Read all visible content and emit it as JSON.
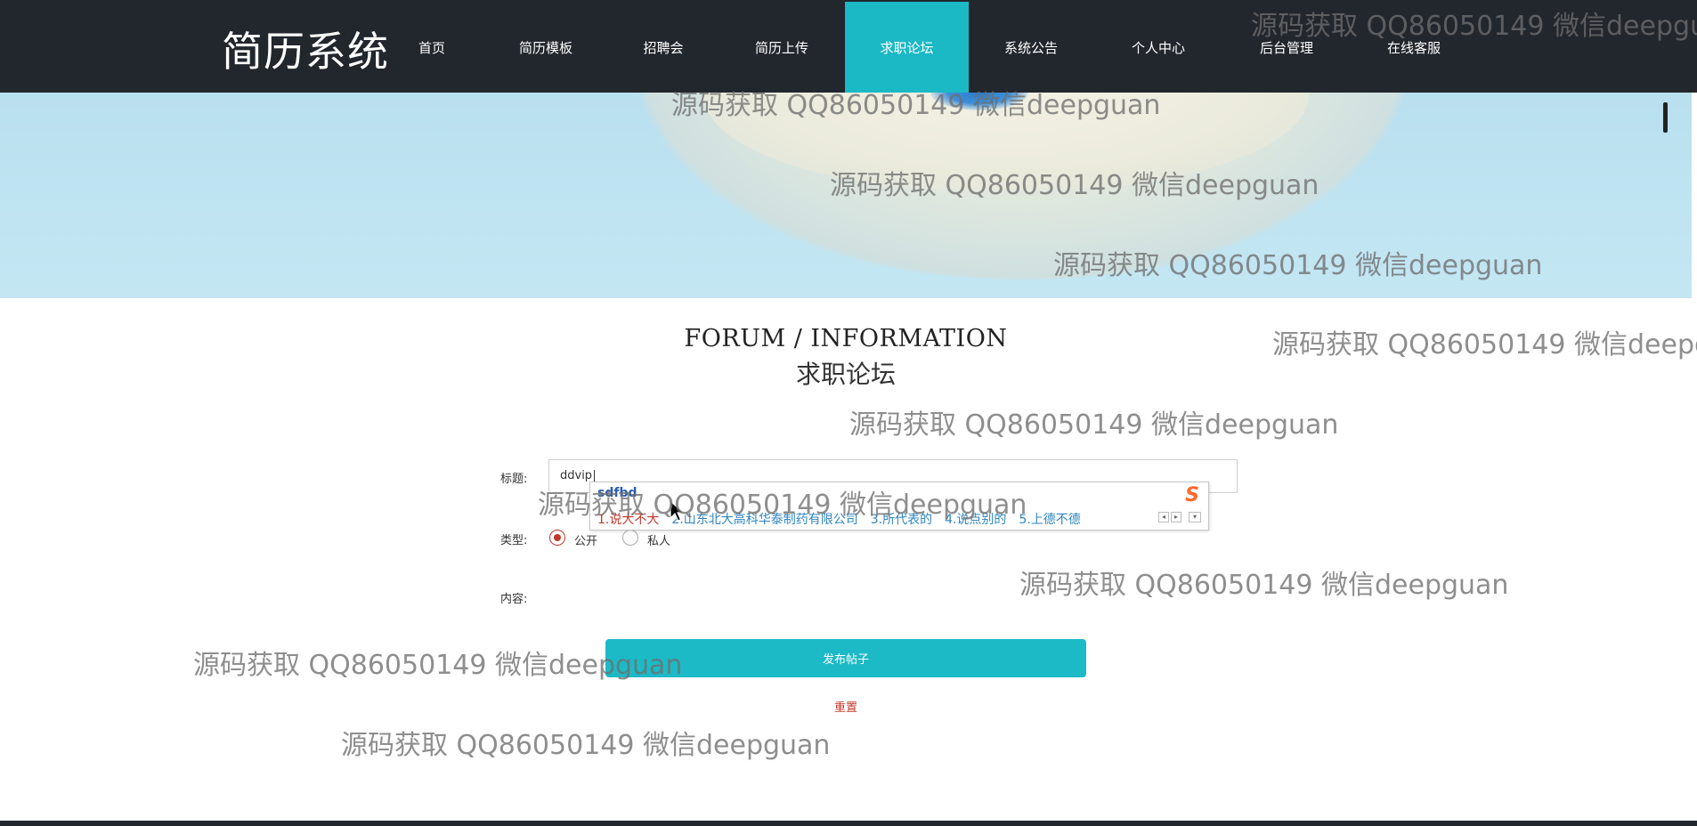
{
  "header": {
    "logo": "简历系统",
    "nav": [
      {
        "label": "首页"
      },
      {
        "label": "简历模板"
      },
      {
        "label": "招聘会"
      },
      {
        "label": "简历上传"
      },
      {
        "label": "求职论坛",
        "active": true
      },
      {
        "label": "系统公告"
      },
      {
        "label": "个人中心"
      },
      {
        "label": "后台管理"
      },
      {
        "label": "在线客服"
      }
    ]
  },
  "section": {
    "title_en": "FORUM / INFORMATION",
    "title_cn": "求职论坛"
  },
  "form": {
    "title_label": "标题:",
    "title_value": "ddvip",
    "type_label": "类型:",
    "type_options": [
      {
        "label": "公开",
        "checked": true
      },
      {
        "label": "私人",
        "checked": false
      }
    ],
    "content_label": "内容:",
    "submit_label": "发布帖子",
    "reset_label": "重置"
  },
  "ime": {
    "pinyin": "sdfbd",
    "candidates": [
      "1.说大不大",
      "2.山东北大高科华泰制药有限公司",
      "3.所代表的",
      "4.说点别的",
      "5.上德不德"
    ],
    "logo": "S"
  },
  "watermark": "源码获取 QQ86050149 微信deepguan",
  "colors": {
    "header_bg": "#22262d",
    "accent": "#1bb8c5",
    "reset": "#c0392b"
  }
}
